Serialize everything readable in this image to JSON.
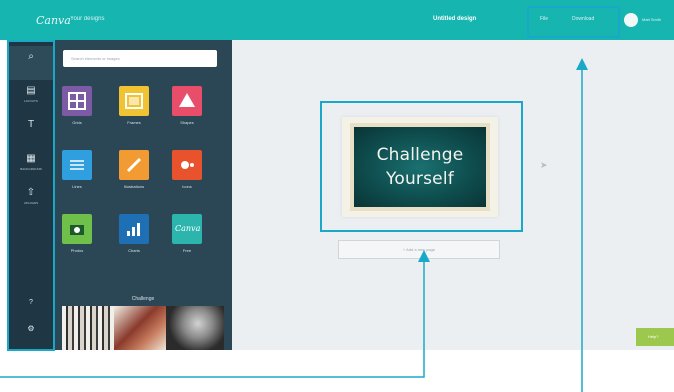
{
  "topbar": {
    "logo": "Canva",
    "home_link": "Your designs",
    "design_title": "Untitled design",
    "file_link": "File",
    "share_link": "Download",
    "user_name": "Matt Smith"
  },
  "rail": {
    "items": [
      {
        "label": "",
        "icon": "search-icon"
      },
      {
        "label": "LAYOUTS",
        "icon": "layout-icon"
      },
      {
        "label": "",
        "icon": "text-icon"
      },
      {
        "label": "BACKGROUND",
        "icon": "background-icon"
      },
      {
        "label": "UPLOADS",
        "icon": "upload-icon"
      }
    ],
    "bottom": [
      {
        "label": "",
        "icon": "help-icon"
      },
      {
        "label": "",
        "icon": "settings-icon"
      }
    ]
  },
  "panel": {
    "search_placeholder": "Search elements or images",
    "tiles": [
      {
        "label": "Grids",
        "color": "#7c5aa6",
        "icon": "grid-icon"
      },
      {
        "label": "Frames",
        "color": "#f1c232",
        "icon": "frame-icon"
      },
      {
        "label": "Shapes",
        "color": "#e84d6a",
        "icon": "shape-icon"
      },
      {
        "label": "Lines",
        "color": "#2f9fe0",
        "icon": "lines-icon"
      },
      {
        "label": "Illustrations",
        "color": "#f29b32",
        "icon": "pencil-icon"
      },
      {
        "label": "Icons",
        "color": "#e8532e",
        "icon": "icons-icon"
      },
      {
        "label": "Photos",
        "color": "#6fbf4b",
        "icon": "camera-icon"
      },
      {
        "label": "Charts",
        "color": "#1e6fb3",
        "icon": "chart-icon"
      },
      {
        "label": "Free",
        "color": "#2cb5ad",
        "icon": "canva-logo-icon"
      }
    ],
    "section_title": "Challenge"
  },
  "canvas": {
    "text_line1": "Challenge",
    "text_line2": "Yourself",
    "add_page_label": "+ Add a new page",
    "help_label": "Help?"
  },
  "colors": {
    "topbar": "#16b5b0",
    "rail": "#1f3744",
    "panel": "#2b4655",
    "canvas_bg": "#ebeff2",
    "annotation": "#1aa8c9",
    "chalkboard": "#0f4e4f"
  }
}
